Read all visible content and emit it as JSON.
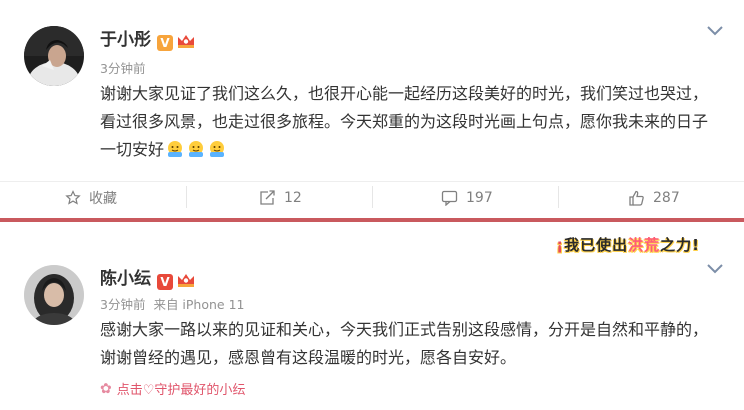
{
  "posts": [
    {
      "user": {
        "name": "于小彤",
        "vip_badge": "V",
        "avatar_icon": "avatar-photo-icon"
      },
      "meta": {
        "time": "3分钟前",
        "source": ""
      },
      "content": "谢谢大家见证了我们这么久，也很开心能一起经历这段美好的时光，我们笑过也哭过，看过很多风景，也走过很多旅程。今天郑重的为这段时光画上句点，愿你我未来的日子一切安好",
      "emoji_count": 3,
      "actions": {
        "favorite_label": "收藏",
        "repost_count": "12",
        "comment_count": "197",
        "like_count": "287"
      }
    },
    {
      "user": {
        "name": "陈小纭",
        "vip_badge": "V",
        "avatar_icon": "avatar-photo-icon"
      },
      "meta": {
        "time": "3分钟前",
        "source": "来自 iPhone 11"
      },
      "content": "感谢大家一路以来的见证和关心，今天我们正式告别这段感情，分开是自然和平静的，谢谢曾经的遇见，感恩曾有这段温暖的时光，愿各自安好。",
      "topic": "点击♡守护最好的小纭",
      "tagline": {
        "prefix": "我已使出",
        "highlight": "洪荒",
        "suffix": "之力!"
      }
    }
  ],
  "colors": {
    "vip_orange": "#f7a43c",
    "vip_red": "#e8493a",
    "divider_red": "#c9595e",
    "topic_pink": "#e0556b"
  }
}
